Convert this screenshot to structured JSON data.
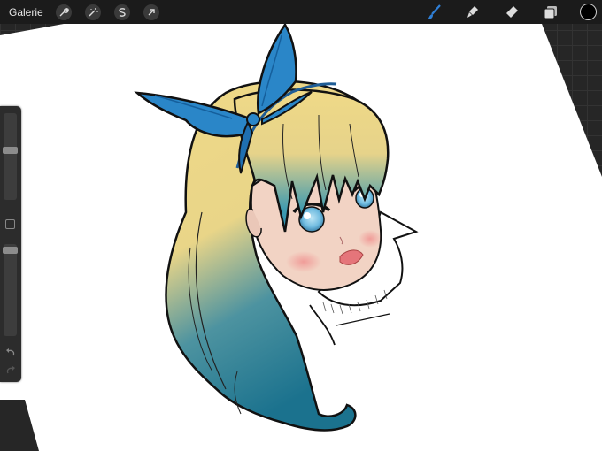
{
  "toolbar": {
    "gallery_label": "Galerie",
    "left_icons": [
      "wrench-icon",
      "magic-wand-icon",
      "selection-s-icon",
      "transform-arrow-icon"
    ],
    "right_tools": [
      "brush-icon",
      "smudge-icon",
      "eraser-icon",
      "layers-icon"
    ],
    "active_tool": "brush-icon",
    "current_color": "#000000",
    "active_color": "#2f7fd6"
  },
  "sidebar": {
    "brush_size": 0.42,
    "brush_opacity": 0.03
  },
  "colors": {
    "hair_blonde": "#efd987",
    "hair_teal": "#1b728e",
    "ribbon_blue": "#2a86c8",
    "skin": "#f2d3c4",
    "canvas": "#ffffff"
  }
}
